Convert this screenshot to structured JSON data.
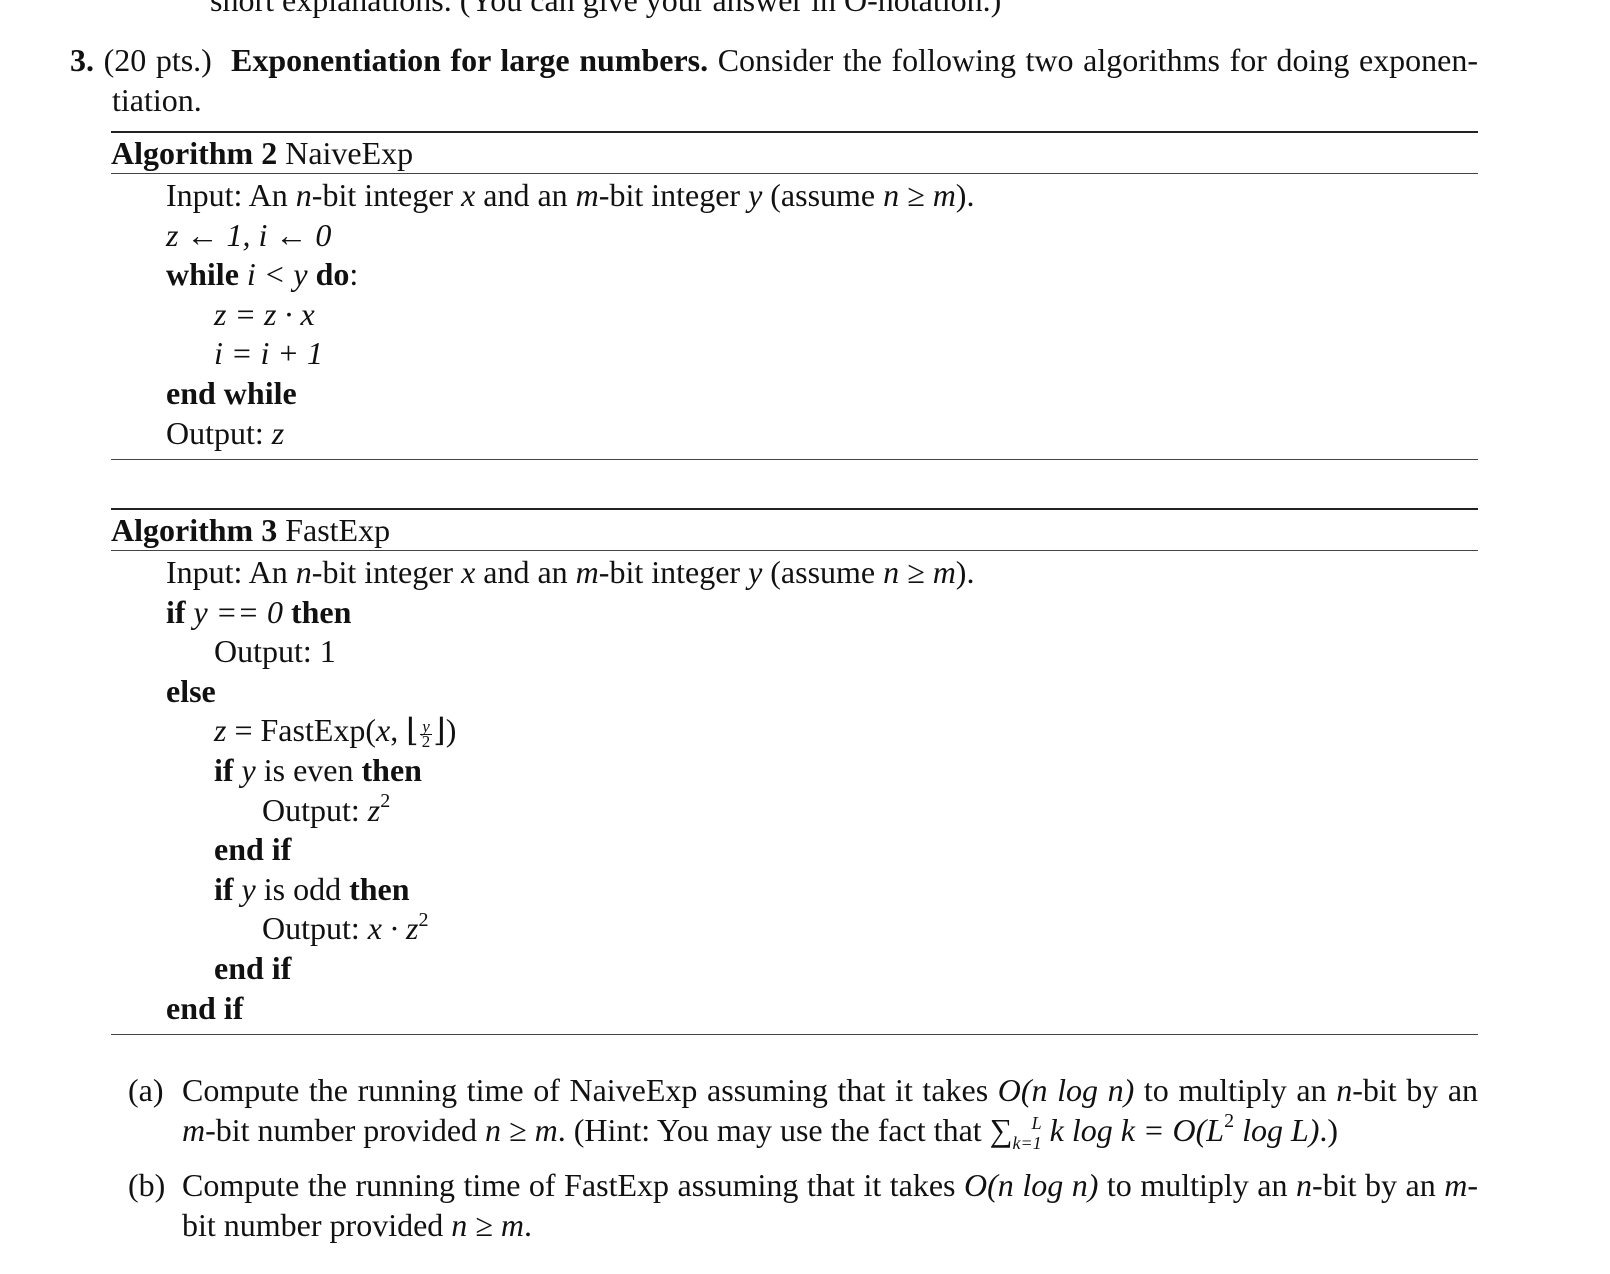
{
  "cutoff_text": "short explanations. (You can give your answer in O-notation.)",
  "problem": {
    "number": "3.",
    "points": "(20 pts.)",
    "title": "Exponentiation for large numbers.",
    "intro_line1": "Consider the following two algorithms for doing exponen-",
    "intro_line2": "tiation."
  },
  "algorithms": [
    {
      "label": "Algorithm 2",
      "name": "NaiveExp",
      "input": {
        "prefix": "Input: An ",
        "n": "n",
        "mid1": "-bit integer ",
        "x": "x",
        "mid2": " and an ",
        "m": "m",
        "mid3": "-bit integer ",
        "y": "y",
        "tail_open": " (assume ",
        "cond": "n ≥ m",
        "tail_close": ")."
      },
      "lines": {
        "init": "z ← 1, i ← 0",
        "while_kw": "while",
        "while_cond": " i < y ",
        "do_kw": "do",
        "do_colon": ":",
        "body1": "z = z · x",
        "body2": "i = i + 1",
        "end_while": "end while",
        "output_label": "Output: ",
        "output_val": "z"
      }
    },
    {
      "label": "Algorithm 3",
      "name": "FastExp",
      "input": {
        "prefix": "Input: An ",
        "n": "n",
        "mid1": "-bit integer ",
        "x": "x",
        "mid2": " and an ",
        "m": "m",
        "mid3": "-bit integer ",
        "y": "y",
        "tail_open": " (assume ",
        "cond": "n ≥ m",
        "tail_close": ")."
      },
      "lines": {
        "if_kw": "if",
        "if_cond": " y == 0 ",
        "then_kw": "then",
        "output1": "Output: 1",
        "else_kw": "else",
        "assign_lhs": "z",
        "assign_eq": " = FastExp(",
        "assign_x": "x",
        "assign_comma": ", ⌊",
        "frac_num": "y",
        "frac_den": "2",
        "assign_close": "⌋)",
        "if_even_kw": "if",
        "even_y": " y ",
        "even_text": "is even ",
        "even_then": "then",
        "out_even_label": "Output: ",
        "out_even_val": "z",
        "out_even_exp": "2",
        "end_if1": "end if",
        "if_odd_kw": "if",
        "odd_y": " y ",
        "odd_text": "is odd ",
        "odd_then": "then",
        "out_odd_label": "Output: ",
        "out_odd_val": "x · z",
        "out_odd_exp": "2",
        "end_if2": "end if",
        "end_if3": "end if"
      }
    }
  ],
  "parts": [
    {
      "label": "(a)",
      "text_1": "Compute the running time of NaiveExp assuming that it takes ",
      "bigo": "O(n log n)",
      "text_2": " to multiply an ",
      "n": "n",
      "text_3": "-bit by an ",
      "m": "m",
      "text_4": "-bit number provided ",
      "cond": "n ≥ m",
      "text_5": ". (Hint: You may use the fact that ",
      "sum_sym": "∑",
      "sum_sup": "L",
      "sum_sub": "k=1",
      "sum_body": " k log k = O(L",
      "sum_exp": "2",
      "sum_tail": " log L)",
      "text_6": ".)"
    },
    {
      "label": "(b)",
      "text_1": "Compute the running time of FastExp assuming that it takes ",
      "bigo": "O(n log n)",
      "text_2": " to multiply an ",
      "n": "n",
      "text_3": "-bit by an ",
      "m": "m",
      "text_4": "-bit number provided ",
      "cond": "n ≥ m",
      "text_5": "."
    }
  ]
}
